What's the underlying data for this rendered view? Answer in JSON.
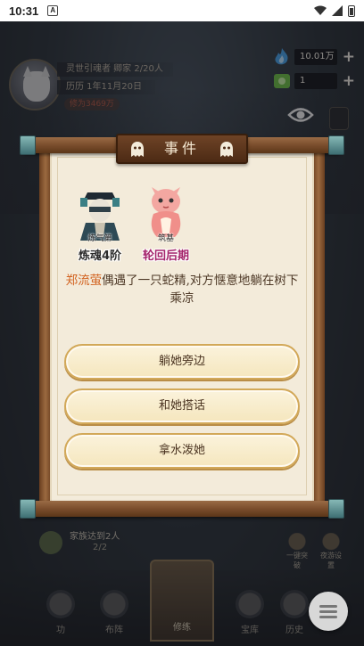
{
  "status_bar": {
    "time": "10:31",
    "notification_badge": "A"
  },
  "hud": {
    "player_line1": "灵世引魂者 卿家 2/20人",
    "player_line2": "历历 1年11月20日",
    "badge": "修为3469万",
    "currency1": {
      "value": "10.01万",
      "plus": "+",
      "icon": "spirit-flame-icon"
    },
    "currency2": {
      "value": "1",
      "plus": "+",
      "icon": "jade-coin-icon"
    }
  },
  "dialog": {
    "title": "事件",
    "characters": [
      {
        "rank": "炼气第",
        "realm": "炼魂4阶",
        "color": "#2d2d2d"
      },
      {
        "rank": "筑基",
        "realm": "轮回后期",
        "color": "#a4236b"
      }
    ],
    "event": {
      "name": "郑流萤",
      "text": "偶遇了一只蛇精,对方惬意地躺在树下乘凉"
    },
    "choices": [
      "躺她旁边",
      "和她搭话",
      "拿水泼她"
    ]
  },
  "background": {
    "family_text": "家族达到2人",
    "family_count": "2/2",
    "right_icons": [
      "一键突破",
      "夜游设置"
    ],
    "nav": [
      "功",
      "布阵",
      "修练",
      "宝库",
      "历史"
    ]
  },
  "colors": {
    "accent_orange": "#d2621f",
    "realm_purple": "#a4236b",
    "paper": "#f3ebda",
    "wood": "#6e4326"
  }
}
